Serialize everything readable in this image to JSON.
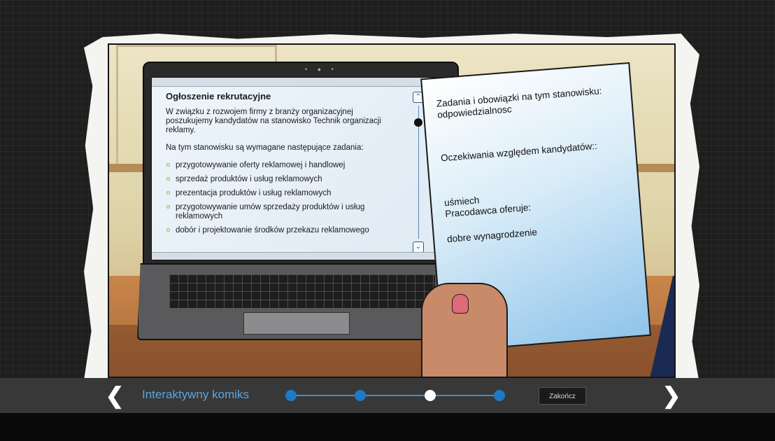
{
  "laptop_screen": {
    "heading": "Ogłoszenie rekrutacyjne",
    "intro": "W związku z rozwojem firmy z branży organizacyjnej poszukujemy kandydatów na stanowisko Technik organizacji reklamy.",
    "requirements_intro": "Na tym stanowisku są wymagane następujące zadania:",
    "tasks": [
      "przygotowywanie oferty reklamowej i handlowej",
      "sprzedaż produktów i usług reklamowych",
      "prezentacja produktów i usług reklamowych",
      "przygotowywanie umów sprzedaży produktów i usług reklamowych",
      "dobór i projektowanie środków przekazu reklamowego"
    ],
    "scroll_up_icon": "chevron-up-icon",
    "scroll_down_icon": "chevron-down-icon"
  },
  "paper_note": {
    "duties_label": "Zadania i obowiązki na tym stanowisku:",
    "duties_value": "odpowiedzialnosc",
    "expectations_label": "Oczekiwania względem kandydatów::",
    "expectations_value": "uśmiech",
    "offer_label": "Pracodawca oferuje:",
    "offer_value": "dobre wynagrodzenie"
  },
  "navbar": {
    "title": "Interaktywny komiks",
    "prev_icon": "chevron-left-icon",
    "next_icon": "chevron-right-icon",
    "finish_label": "Zakończ",
    "steps_total": 4,
    "active_step": 3,
    "accent_color": "#1e7ac8"
  }
}
